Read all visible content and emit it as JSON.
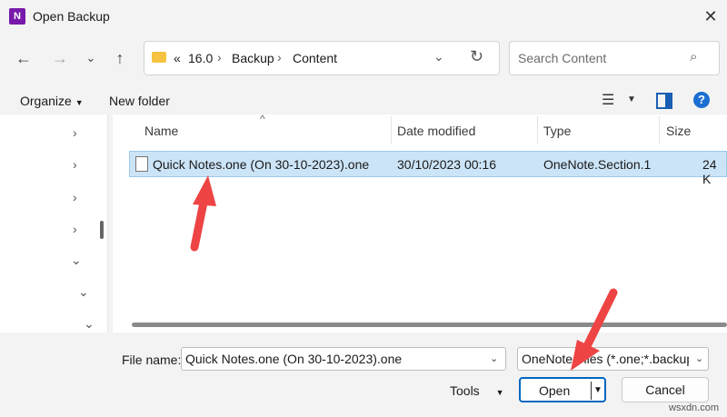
{
  "window": {
    "title": "Open Backup",
    "app_icon_letter": "N"
  },
  "address": {
    "crumbs": [
      "«",
      "16.0",
      "Backup",
      "Content"
    ]
  },
  "search": {
    "placeholder": "Search Content"
  },
  "toolbar": {
    "organize": "Organize",
    "new_folder": "New folder"
  },
  "columns": {
    "name": "Name",
    "date_modified": "Date modified",
    "type": "Type",
    "size": "Size"
  },
  "files": [
    {
      "name": "Quick Notes.one (On 30-10-2023).one",
      "date_modified": "30/10/2023 00:16",
      "type": "OneNote.Section.1",
      "size": "24 K"
    }
  ],
  "bottom": {
    "file_name_label": "File name:",
    "file_name_value": "Quick Notes.one (On 30-10-2023).one",
    "filter_value": "OneNote Files (*.one;*.backup)",
    "tools_label": "Tools",
    "open_label": "Open",
    "cancel_label": "Cancel"
  },
  "watermark": "wsxdn.com",
  "colors": {
    "selection": "#cce4f7",
    "accent": "#0067c0",
    "annotation_arrow": "#ee4444"
  }
}
